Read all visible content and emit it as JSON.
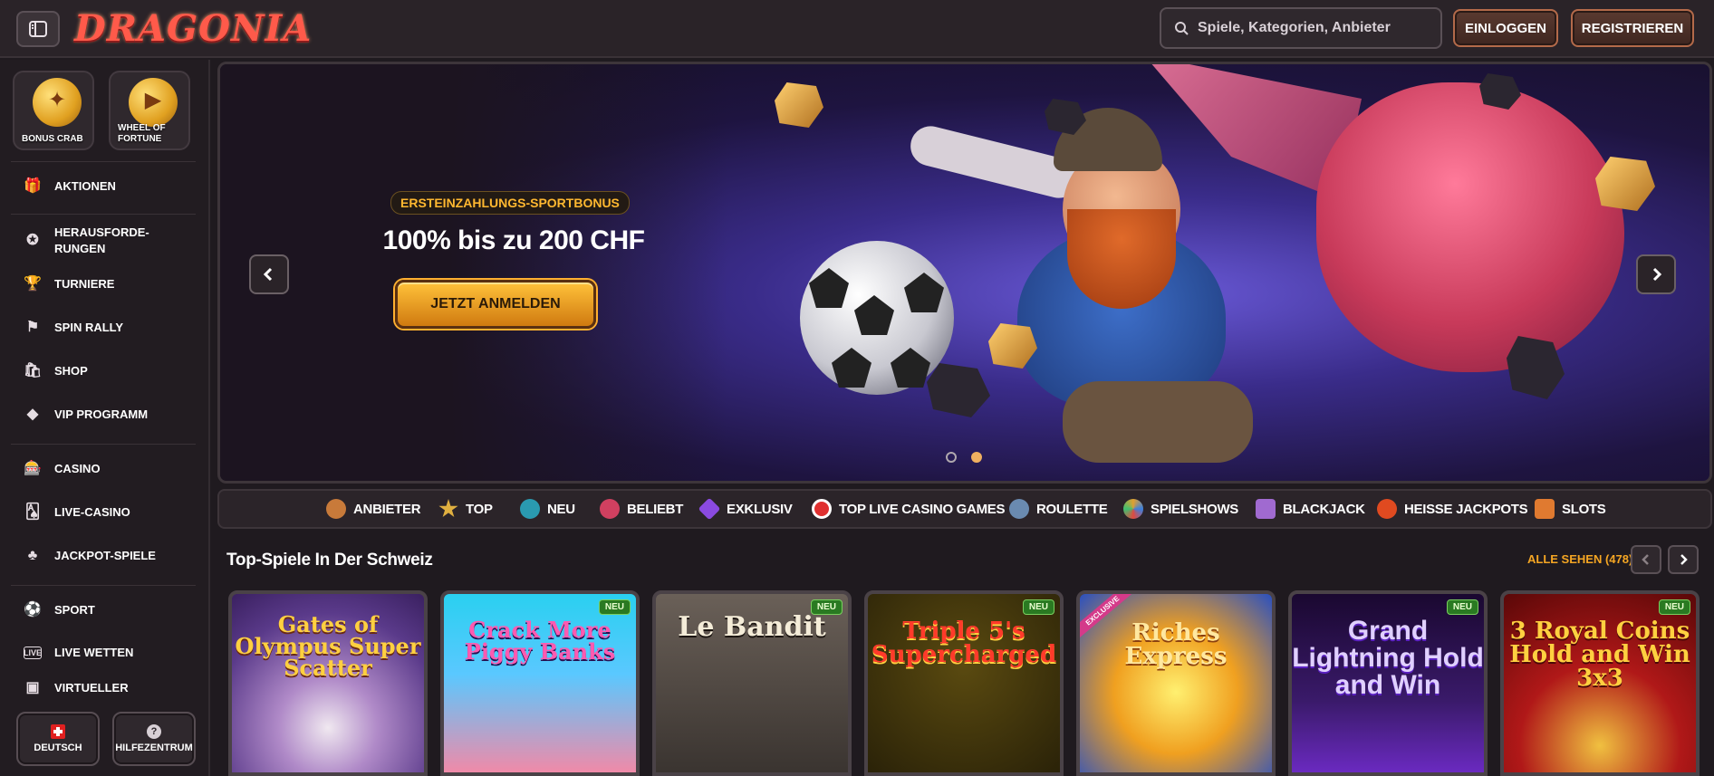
{
  "brand": {
    "logo_text": "DRAGONIA"
  },
  "header": {
    "search_placeholder": "Spiele, Kategorien, Anbieter",
    "login_label": "EINLOGGEN",
    "register_label": "REGISTRIEREN"
  },
  "sidebar": {
    "promos": [
      {
        "label": "BONUS CRAB",
        "icon": "crab-coin-icon"
      },
      {
        "label": "WHEEL OF FORTUNE",
        "icon": "wheel-coin-icon"
      }
    ],
    "items": [
      {
        "label": "AKTIONEN",
        "icon": "gift-icon"
      },
      {
        "label": "HERAUSFORDE-RUNGEN",
        "icon": "badge-icon"
      },
      {
        "label": "TURNIERE",
        "icon": "trophy-icon"
      },
      {
        "label": "SPIN RALLY",
        "icon": "rally-icon"
      },
      {
        "label": "SHOP",
        "icon": "shopping-bag-icon"
      },
      {
        "label": "VIP PROGRAMM",
        "icon": "diamond-icon"
      },
      {
        "label": "CASINO",
        "icon": "slot-machine-icon"
      },
      {
        "label": "LIVE-CASINO",
        "icon": "cards-icon"
      },
      {
        "label": "JACKPOT-SPIELE",
        "icon": "clover-icon"
      },
      {
        "label": "SPORT",
        "icon": "basketball-icon"
      },
      {
        "label": "LIVE WETTEN",
        "icon": "live-icon"
      },
      {
        "label": "VIRTUELLER",
        "icon": "virtual-icon"
      }
    ],
    "footer": {
      "language_label": "DEUTSCH",
      "help_label": "HILFEZENTRUM"
    }
  },
  "hero": {
    "kicker": "ERSTEINZAHLUNGS-SPORTBONUS",
    "headline": "100% bis zu 200 CHF",
    "cta_label": "JETZT ANMELDEN",
    "slide_count": 2,
    "active_slide": 2
  },
  "categories": [
    {
      "label": "ANBIETER",
      "color": "#c87a3a"
    },
    {
      "label": "TOP",
      "color": "#e0b040"
    },
    {
      "label": "NEU",
      "color": "#2a9ab0"
    },
    {
      "label": "BELIEBT",
      "color": "#d04060"
    },
    {
      "label": "EXKLUSIV",
      "color": "#8a4ae0"
    },
    {
      "label": "TOP LIVE CASINO GAMES",
      "color": "#e03030"
    },
    {
      "label": "ROULETTE",
      "color": "#6a8ab0"
    },
    {
      "label": "SPIELSHOWS",
      "color": "#e0a030"
    },
    {
      "label": "BLACKJACK",
      "color": "#a06ad0"
    },
    {
      "label": "HEISSE JACKPOTS",
      "color": "#e04a20"
    },
    {
      "label": "SLOTS",
      "color": "#e07a30"
    }
  ],
  "games_section": {
    "title": "Top-Spiele In Der Schweiz",
    "see_all": "ALLE SEHEN (478)",
    "games": [
      {
        "title": "Gates of Olympus Super Scatter",
        "badge": ""
      },
      {
        "title": "Crack More Piggy Banks",
        "badge": "NEU"
      },
      {
        "title": "Le Bandit",
        "badge": "NEU"
      },
      {
        "title": "Triple 5's Supercharged",
        "badge": "NEU"
      },
      {
        "title": "Riches Express",
        "badge": "EXCLUSIVE"
      },
      {
        "title": "Grand Lightning Hold and Win",
        "badge": "NEU"
      },
      {
        "title": "3 Royal Coins Hold and Win 3x3",
        "badge": "NEU"
      }
    ]
  },
  "colors": {
    "accent_gold": "#f5a623",
    "background": "#1f1a1f",
    "panel": "#2a2328"
  }
}
